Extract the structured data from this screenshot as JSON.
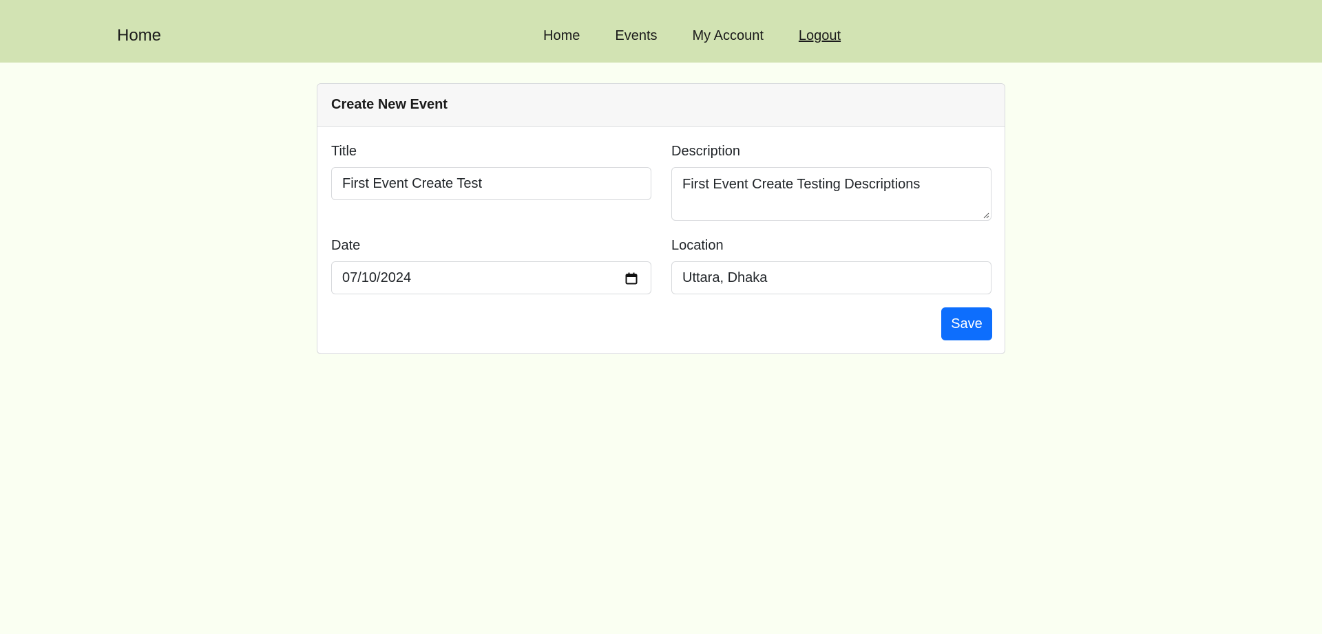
{
  "navbar": {
    "brand": "Home",
    "links": [
      {
        "label": "Home"
      },
      {
        "label": "Events"
      },
      {
        "label": "My Account"
      },
      {
        "label": "Logout"
      }
    ]
  },
  "form": {
    "title": "Create New Event",
    "fields": {
      "title": {
        "label": "Title",
        "value": "First Event Create Test"
      },
      "description": {
        "label": "Description",
        "value": "First Event Create Testing Descriptions"
      },
      "date": {
        "label": "Date",
        "value": "07/10/2024"
      },
      "location": {
        "label": "Location",
        "value": "Uttara, Dhaka"
      }
    },
    "save_label": "Save"
  },
  "colors": {
    "navbar_bg": "#d2e3b3",
    "page_bg": "#fafff2",
    "primary": "#0d6efd"
  },
  "icons": {
    "calendar": "calendar-icon",
    "resize": "resize-grip-icon"
  }
}
